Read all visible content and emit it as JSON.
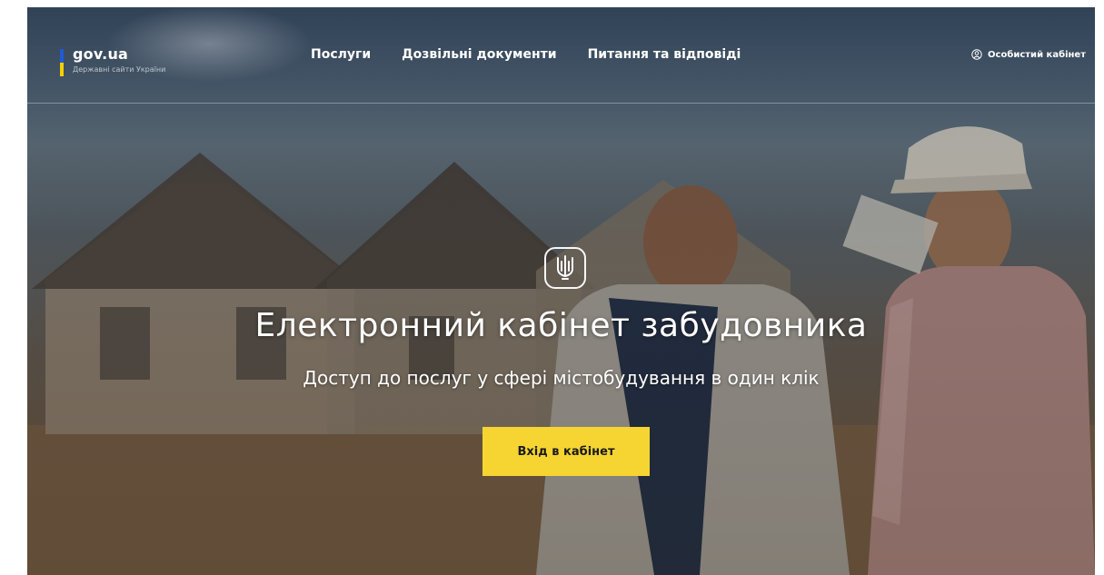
{
  "header": {
    "logo": {
      "title": "gov.ua",
      "subtitle": "Державні сайти України",
      "flag_colors": [
        "#1f5bd6",
        "#f5d000"
      ]
    },
    "nav": [
      {
        "label": "Послуги"
      },
      {
        "label": "Дозвільні документи"
      },
      {
        "label": "Питання та відповіді"
      }
    ],
    "cabinet_link": {
      "label": "Особистий кабінет",
      "icon": "user-circle-icon"
    }
  },
  "hero": {
    "emblem_icon": "trident-icon",
    "title": "Електронний кабінет забудовника",
    "subtitle": "Доступ до послуг у сфері містобудування в один клік",
    "cta_label": "Вхід в кабінет",
    "cta_color": "#f6d532"
  }
}
